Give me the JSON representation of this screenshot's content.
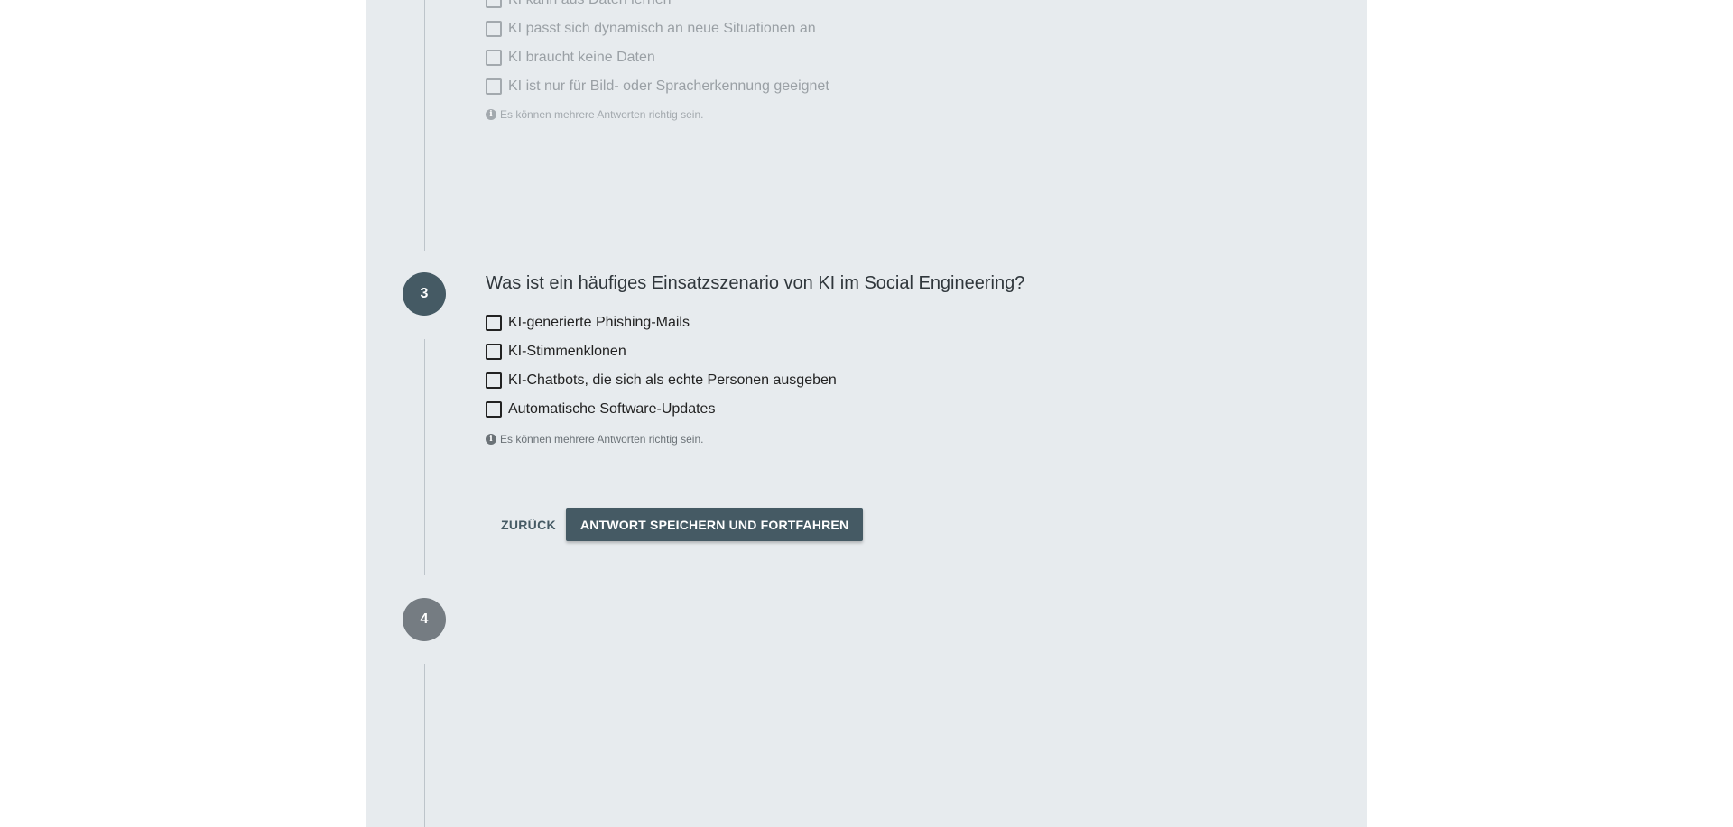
{
  "step2": {
    "options": [
      {
        "label": "KI kann aus Daten lernen",
        "checked": false
      },
      {
        "label": "KI passt sich dynamisch an neue Situationen an",
        "checked": false
      },
      {
        "label": "KI braucht keine Daten",
        "checked": false
      },
      {
        "label": "KI ist nur für Bild- oder Spracherkennung geeignet",
        "checked": false
      }
    ],
    "hint": "Es können mehrere Antworten richtig sein."
  },
  "step3": {
    "number": "3",
    "question": "Was ist ein häufiges Einsatzszenario von KI im Social Engineering?",
    "options": [
      {
        "label": "KI-generierte Phishing-Mails",
        "checked": false
      },
      {
        "label": "KI-Stimmenklonen",
        "checked": false
      },
      {
        "label": "KI-Chatbots, die sich als echte Personen ausgeben",
        "checked": false
      },
      {
        "label": "Automatische Software-Updates",
        "checked": false
      }
    ],
    "hint": "Es können mehrere Antworten richtig sein.",
    "back_label": "ZURÜCK",
    "submit_label": "ANTWORT SPEICHERN UND FORTFAHREN"
  },
  "step4": {
    "number": "4"
  },
  "icons": {
    "info": "info-icon"
  },
  "colors": {
    "panel_bg": "#e7ebee",
    "step_active": "#455a64",
    "step_inactive": "#757c82",
    "primary": "#455a64"
  }
}
